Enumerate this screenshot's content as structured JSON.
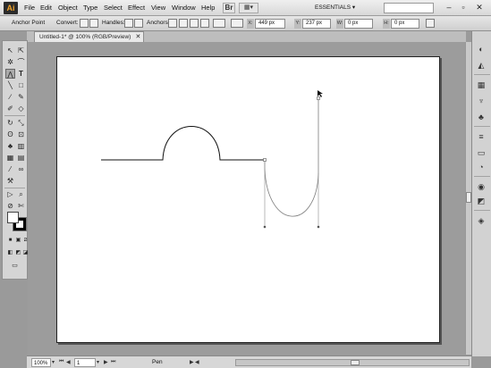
{
  "app": {
    "logo": "Ai",
    "menus": [
      "File",
      "Edit",
      "Object",
      "Type",
      "Select",
      "Effect",
      "View",
      "Window",
      "Help"
    ],
    "bridge_label": "Br",
    "workspace": "ESSENTIALS",
    "window_controls": [
      "–",
      "▫",
      "✕"
    ]
  },
  "control_bar": {
    "selection_label": "Anchor Point",
    "convert_label": "Convert:",
    "handles_label": "Handles:",
    "anchors_label": "Anchors",
    "x_label": "X:",
    "x_value": "449 px",
    "y_label": "Y:",
    "y_value": "237 px",
    "w_label": "W:",
    "w_value": "0 px",
    "h_label": "H:",
    "h_value": "0 px"
  },
  "document": {
    "tab_title": "Untitled-1* @ 100% (RGB/Preview)",
    "tab_close": "✕"
  },
  "status_bar": {
    "zoom": "100%",
    "artboard_number": "1",
    "tool_status": "Pen"
  },
  "icons": {
    "selection": "selection-arrow-icon",
    "direct_selection": "direct-selection-icon",
    "pen": "pen-icon",
    "type": "type-icon",
    "anchor_point": "anchor-point-icon"
  },
  "colors": {
    "fill": "#ffffff",
    "stroke": "#000000",
    "path_stroke": "#111111",
    "selected_path": "#7a7a7a"
  }
}
